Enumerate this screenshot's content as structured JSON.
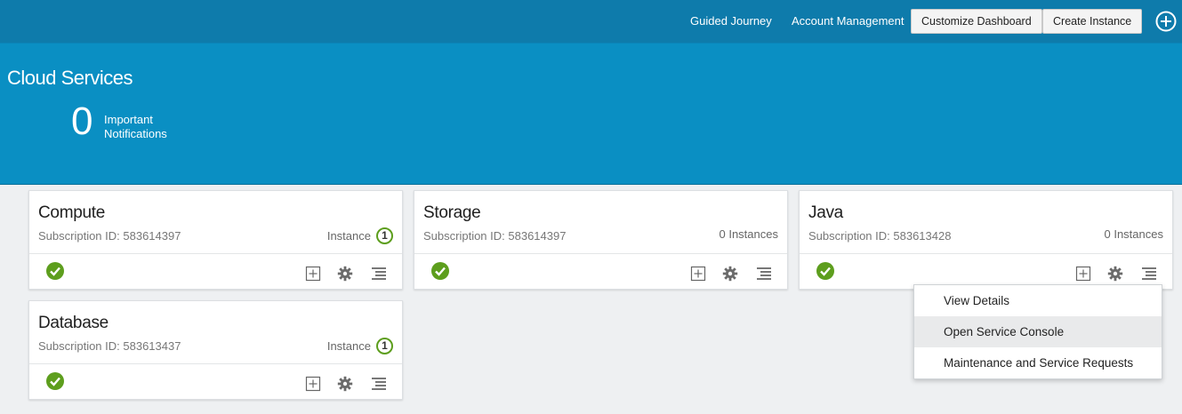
{
  "topbar": {
    "links": [
      "Guided Journey",
      "Account Management"
    ],
    "buttons": [
      "Customize Dashboard",
      "Create Instance"
    ],
    "add_icon": "plus-circle-icon"
  },
  "hero": {
    "title": "Cloud Services",
    "notification_count": "0",
    "notification_label_1": "Important",
    "notification_label_2": "Notifications"
  },
  "cards": [
    {
      "title": "Compute",
      "subscription": "Subscription ID: 583614397",
      "count_label": "Instance",
      "count_badge": "1"
    },
    {
      "title": "Storage",
      "subscription": "Subscription ID: 583614397",
      "count_label": "0 Instances",
      "count_badge": ""
    },
    {
      "title": "Java",
      "subscription": "Subscription ID: 583613428",
      "count_label": "0 Instances",
      "count_badge": ""
    },
    {
      "title": "Database",
      "subscription": "Subscription ID: 583613437",
      "count_label": "Instance",
      "count_badge": "1"
    }
  ],
  "menu": {
    "items": [
      "View Details",
      "Open Service Console",
      "Maintenance and Service Requests"
    ],
    "highlighted_index": 1
  },
  "colors": {
    "topbar": "#0e7bab",
    "hero": "#0a8fc3",
    "status_ok": "#5d9e1d"
  }
}
